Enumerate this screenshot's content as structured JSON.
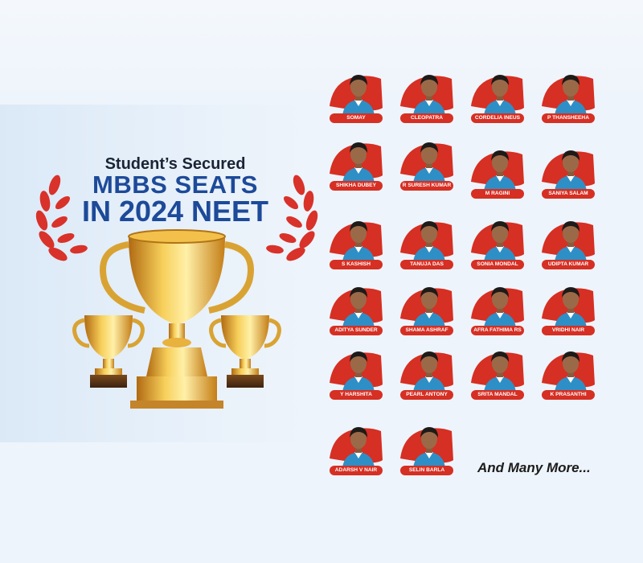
{
  "heading": {
    "subtitle": "Student’s Secured",
    "title_line1": "MBBS SEATS",
    "title_line2": "IN 2024 NEET"
  },
  "colors": {
    "accent_red": "#d62f23",
    "title_blue": "#1d4a99",
    "uniform_blue": "#2e8fc7",
    "gold": "#e0a02a"
  },
  "students": [
    {
      "name": "SOMAY"
    },
    {
      "name": "CLEOPATRA"
    },
    {
      "name": "CORDELIA INEUS"
    },
    {
      "name": "P THANSHEEHA"
    },
    {
      "name": "SHIKHA DUBEY"
    },
    {
      "name": "R SURESH KUMAR"
    },
    {
      "name": "M RAGINI"
    },
    {
      "name": "SANIYA SALAM"
    },
    {
      "name": "S KASHISH"
    },
    {
      "name": "TANUJA DAS"
    },
    {
      "name": "SONIA MONDAL"
    },
    {
      "name": "UDIPTA KUMAR"
    },
    {
      "name": "ADITYA SUNDER"
    },
    {
      "name": "SHAMA ASHRAF"
    },
    {
      "name": "AFRA FATHIMA RS"
    },
    {
      "name": "VRIDHI NAIR"
    },
    {
      "name": "Y HARSHITA"
    },
    {
      "name": "PEARL ANTONY"
    },
    {
      "name": "SRITA MANDAL"
    },
    {
      "name": "K PRASANTHI"
    },
    {
      "name": "ADARSH V NAIR"
    },
    {
      "name": "SELIN BARLA"
    }
  ],
  "footer_text": "And Many More..."
}
